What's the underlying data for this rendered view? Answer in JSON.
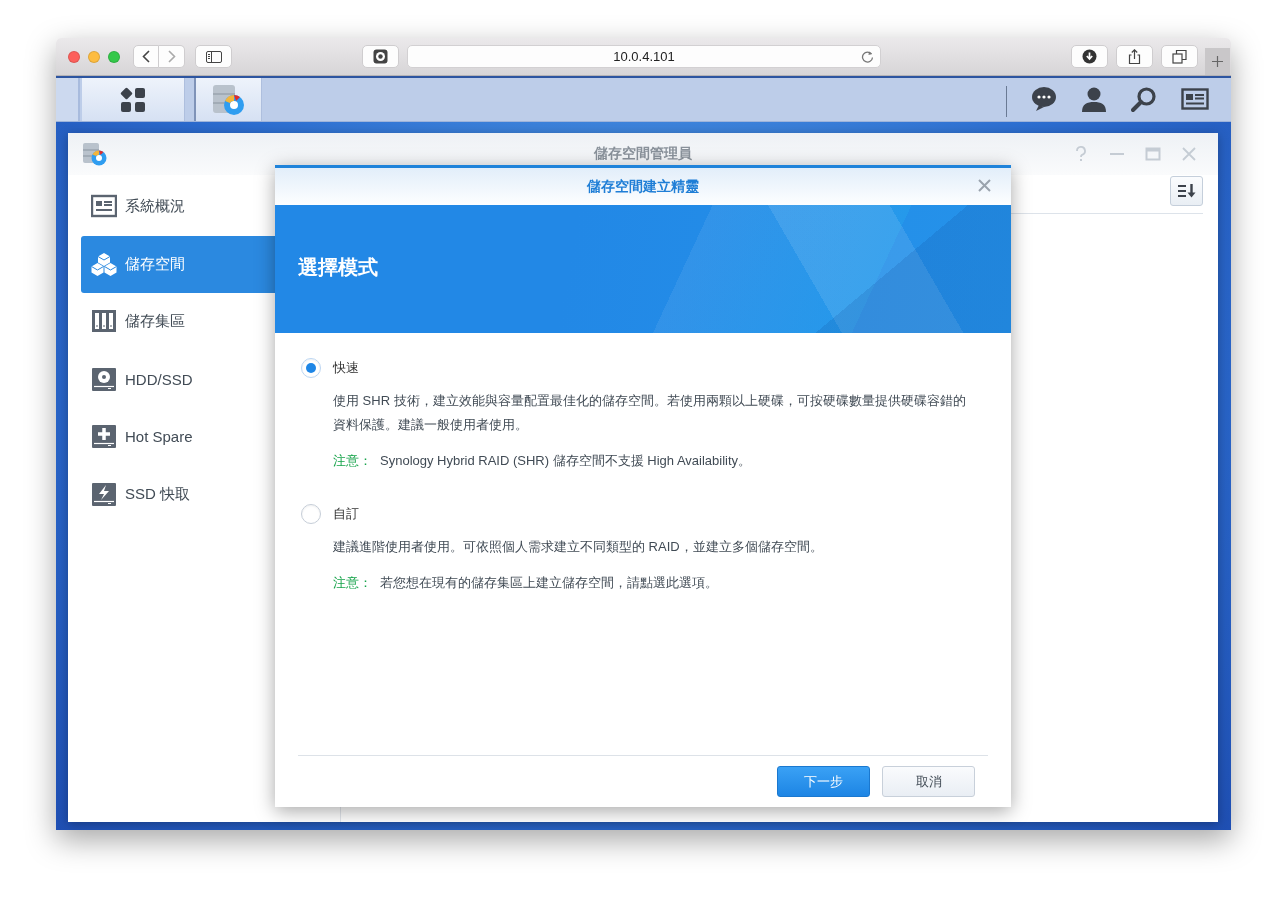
{
  "browser": {
    "address": "10.0.4.101"
  },
  "app_window": {
    "title": "儲存空間管理員"
  },
  "sidebar": {
    "items": [
      {
        "label": "系統概況",
        "kind": "overview",
        "selected": false
      },
      {
        "label": "儲存空間",
        "kind": "volume",
        "selected": true
      },
      {
        "label": "儲存集區",
        "kind": "pool",
        "selected": false
      },
      {
        "label": "HDD/SSD",
        "kind": "disk",
        "selected": false
      },
      {
        "label": "Hot Spare",
        "kind": "spare",
        "selected": false
      },
      {
        "label": "SSD 快取",
        "kind": "cache",
        "selected": false
      }
    ]
  },
  "dialog": {
    "title": "儲存空間建立精靈",
    "banner_title": "選擇模式",
    "options": [
      {
        "label": "快速",
        "selected": true,
        "description": "使用 SHR 技術，建立效能與容量配置最佳化的儲存空間。若使用兩顆以上硬碟，可按硬碟數量提供硬碟容錯的資料保護。建議一般使用者使用。",
        "note_label": "注意：",
        "note": "Synology Hybrid RAID (SHR) 儲存空間不支援 High Availability。"
      },
      {
        "label": "自訂",
        "selected": false,
        "description": "建議進階使用者使用。可依照個人需求建立不同類型的 RAID，並建立多個儲存空間。",
        "note_label": "注意：",
        "note": "若您想在現有的儲存集區上建立儲存空間，請點選此選項。"
      }
    ],
    "buttons": [
      {
        "label": "下一步",
        "kind": "primary"
      },
      {
        "label": "取消",
        "kind": "secondary"
      }
    ]
  }
}
